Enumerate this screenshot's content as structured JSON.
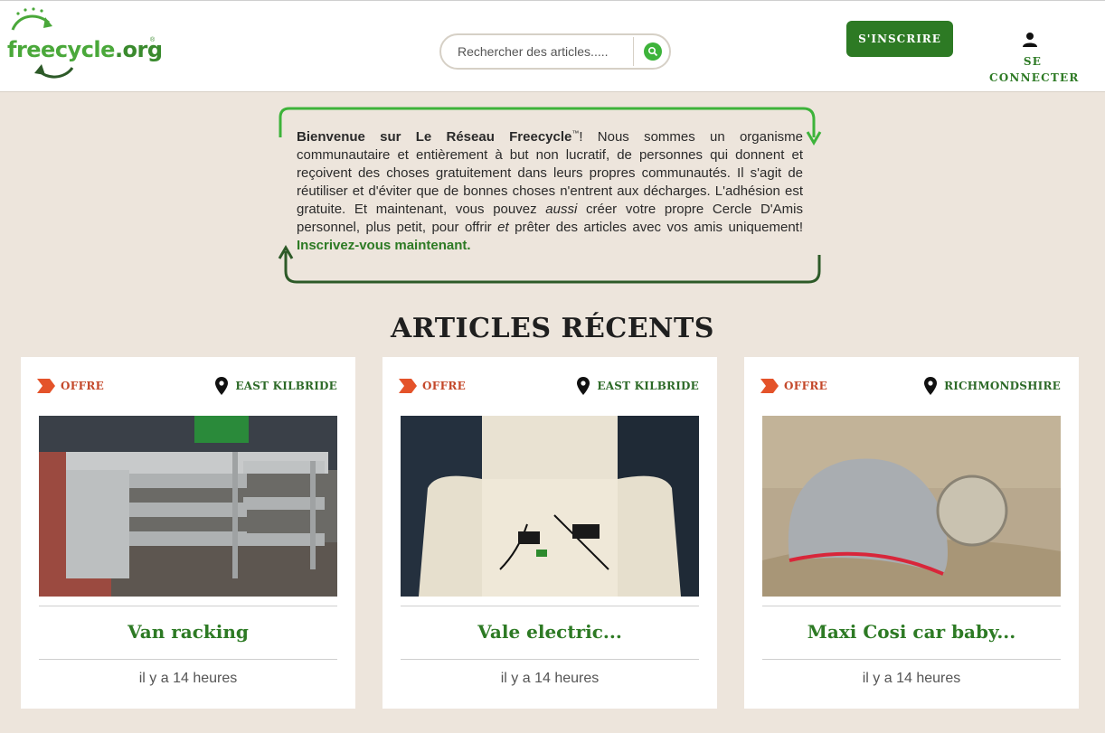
{
  "header": {
    "logo_text_free": "freecycle",
    "logo_text_org": ".org",
    "logo_reg": "®",
    "search_placeholder": "Rechercher des articles.....",
    "signup_label": "S'INSCRIRE",
    "login_label_line1": "SE",
    "login_label_line2": "CONNECTER"
  },
  "welcome": {
    "lead": "Bienvenue sur Le Réseau Freecycle",
    "tm": "™",
    "body": "! Nous sommes un organisme communautaire et entièrement à but non lucratif, de personnes qui donnent et reçoivent des choses gratuitement dans leurs propres communautés. Il s'agit de réutiliser et d'éviter que de bonnes choses n'entrent aux décharges. L'adhésion est gratuite. Et maintenant, vous pouvez ",
    "aussi": "aussi",
    "body2": " créer votre propre Cercle D'Amis personnel, plus petit, pour offrir ",
    "et": "et",
    "body3": " prêter des articles avec vos amis uniquement! ",
    "cta": "Inscrivez-vous maintenant."
  },
  "section_title": "ARTICLES RÉCENTS",
  "cards": [
    {
      "type": "OFFRE",
      "location": "EAST KILBRIDE",
      "title": "Van racking",
      "time": "il y a 14 heures"
    },
    {
      "type": "OFFRE",
      "location": "EAST KILBRIDE",
      "title": "Vale electric...",
      "time": "il y a 14 heures"
    },
    {
      "type": "OFFRE",
      "location": "RICHMONDSHIRE",
      "title": "Maxi Cosi car baby...",
      "time": "il y a 14 heures"
    }
  ],
  "colors": {
    "brand_green": "#2d7a24",
    "light_green": "#3db33a",
    "offer_orange": "#c4482a",
    "background": "#ede5dc"
  }
}
